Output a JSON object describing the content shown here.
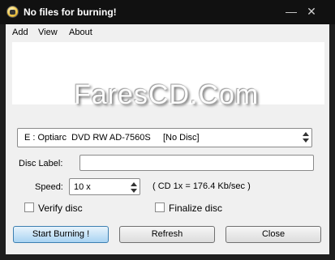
{
  "window": {
    "title": "No files for burning!"
  },
  "menu": {
    "items": [
      "Add",
      "View",
      "About"
    ]
  },
  "banner": {
    "watermark": "FaresCD.Com"
  },
  "drive": {
    "selected": "E : Optiarc  DVD RW AD-7560S     [No Disc]"
  },
  "disc_label": {
    "label": "Disc Label:",
    "value": ""
  },
  "speed": {
    "label": "Speed:",
    "value": "10 x",
    "info": "( CD 1x = 176.4 Kb/sec )"
  },
  "options": {
    "verify_label": "Verify disc",
    "verify_checked": false,
    "finalize_label": "Finalize disc",
    "finalize_checked": false
  },
  "buttons": {
    "start": "Start Burning !",
    "refresh": "Refresh",
    "close": "Close"
  },
  "title_buttons": {
    "minimize": "—",
    "close": "✕"
  }
}
